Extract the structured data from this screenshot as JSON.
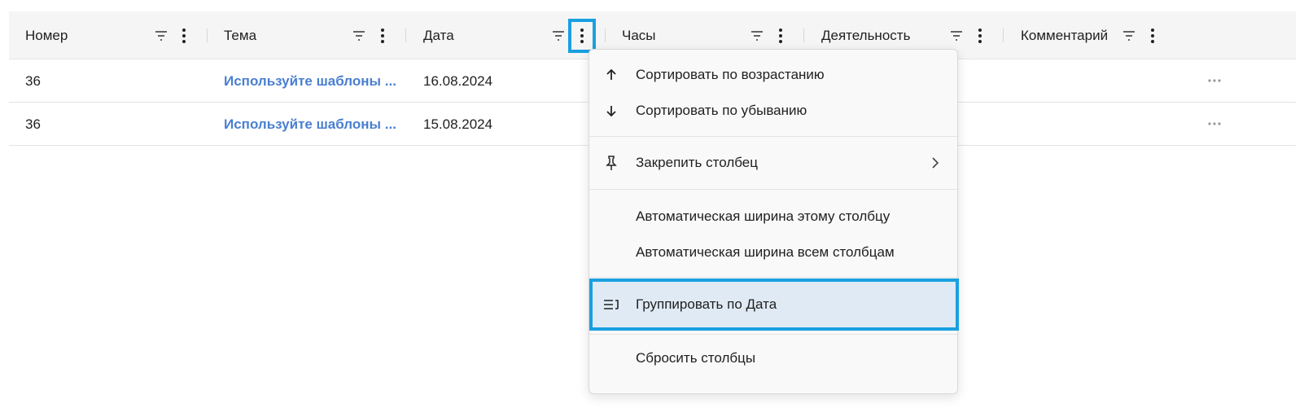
{
  "grid": {
    "columns": [
      {
        "label": "Номер",
        "filter_icon": "filter-icon",
        "menu_icon": "more-vertical-icon"
      },
      {
        "label": "Тема",
        "filter_icon": "filter-icon",
        "menu_icon": "more-vertical-icon"
      },
      {
        "label": "Дата",
        "filter_icon": "filter-icon",
        "menu_icon": "more-vertical-icon"
      },
      {
        "label": "Часы",
        "filter_icon": "filter-icon",
        "menu_icon": "more-vertical-icon"
      },
      {
        "label": "Деятельность",
        "filter_icon": "filter-icon",
        "menu_icon": "more-vertical-icon"
      },
      {
        "label": "Комментарий",
        "filter_icon": "filter-icon",
        "menu_icon": "more-vertical-icon"
      }
    ],
    "rows": [
      {
        "number": "36",
        "topic": "Используйте шаблоны ...",
        "date": "16.08.2024",
        "more_icon": "more-horizontal-icon"
      },
      {
        "number": "36",
        "topic": "Используйте шаблоны ...",
        "date": "15.08.2024",
        "more_icon": "more-horizontal-icon"
      }
    ]
  },
  "column_menu": {
    "items": [
      {
        "label": "Сортировать по возрастанию",
        "icon": "arrow-up-icon"
      },
      {
        "label": "Сортировать по убыванию",
        "icon": "arrow-down-icon"
      },
      {
        "label": "Закрепить столбец",
        "icon": "pin-icon",
        "submenu_icon": "chevron-right-icon"
      },
      {
        "label": "Автоматическая ширина этому столбцу"
      },
      {
        "label": "Автоматическая ширина всем столбцам"
      },
      {
        "label": "Группировать по Дата",
        "icon": "group-icon"
      },
      {
        "label": "Сбросить столбцы"
      }
    ]
  },
  "colors": {
    "highlight_outline": "#19a0e0",
    "highlight_fill": "#dfeaf5",
    "link": "#4a7fd0",
    "header_bg": "#f5f5f5"
  }
}
